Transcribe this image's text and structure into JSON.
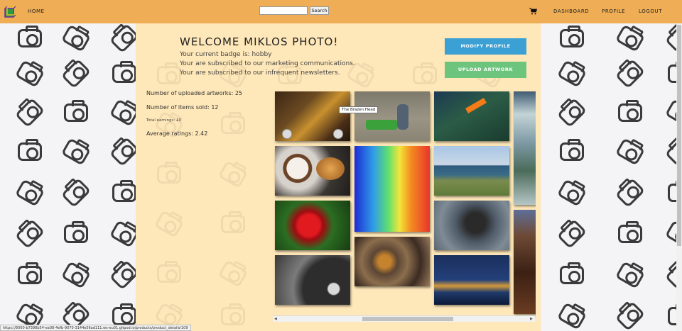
{
  "nav": {
    "home": "HOME",
    "search_button": "Search",
    "search_value": "",
    "dashboard": "DASHBOARD",
    "profile": "PROFILE",
    "logout": "LOGOUT",
    "accent_color": "#efae55"
  },
  "welcome": {
    "title": "WELCOME MIKLOS PHOTO!",
    "badge_line": "Your current badge is: hobby",
    "marketing_line": "Your are subscribed to our marketing communications.",
    "newsletter_line": "Your are subscribed to our infrequent newsletters."
  },
  "actions": {
    "modify_profile": "MODIFY PROFILE",
    "upload_artwork": "UPLOAD ARTWORK",
    "modify_color": "#3ba0d3",
    "upload_color": "#6dc57d"
  },
  "stats": {
    "uploaded": "Number of uploaded artworks: 25",
    "sold": "Number of items sold: 12",
    "earnings": "Total earnings: £0",
    "ratings": "Average ratings: 2.42"
  },
  "gallery": {
    "tooltip": "The Brazen Head",
    "items": [
      {
        "icon": "pub-interior-photo"
      },
      {
        "icon": "child-on-bench-photo"
      },
      {
        "icon": "bird-of-paradise-flower-photo"
      },
      {
        "icon": "coffee-croissant-photo"
      },
      {
        "icon": "thermal-drink-photo"
      },
      {
        "icon": "coastal-cliff-photo"
      },
      {
        "icon": "red-rose-photo"
      },
      {
        "icon": "chimpanzee-photo"
      },
      {
        "icon": "bmw-wheel-photo"
      },
      {
        "icon": "dried-fruit-photo"
      },
      {
        "icon": "night-bridge-photo"
      },
      {
        "icon": "waterfall-photo"
      },
      {
        "icon": "coffee-beans-photo"
      }
    ]
  },
  "status_bar": {
    "url": "https://8000-b7398b54-ea08-4efb-9070-3144e56ad111.ws-eu01.gitpod.io/products/product_details/109"
  }
}
